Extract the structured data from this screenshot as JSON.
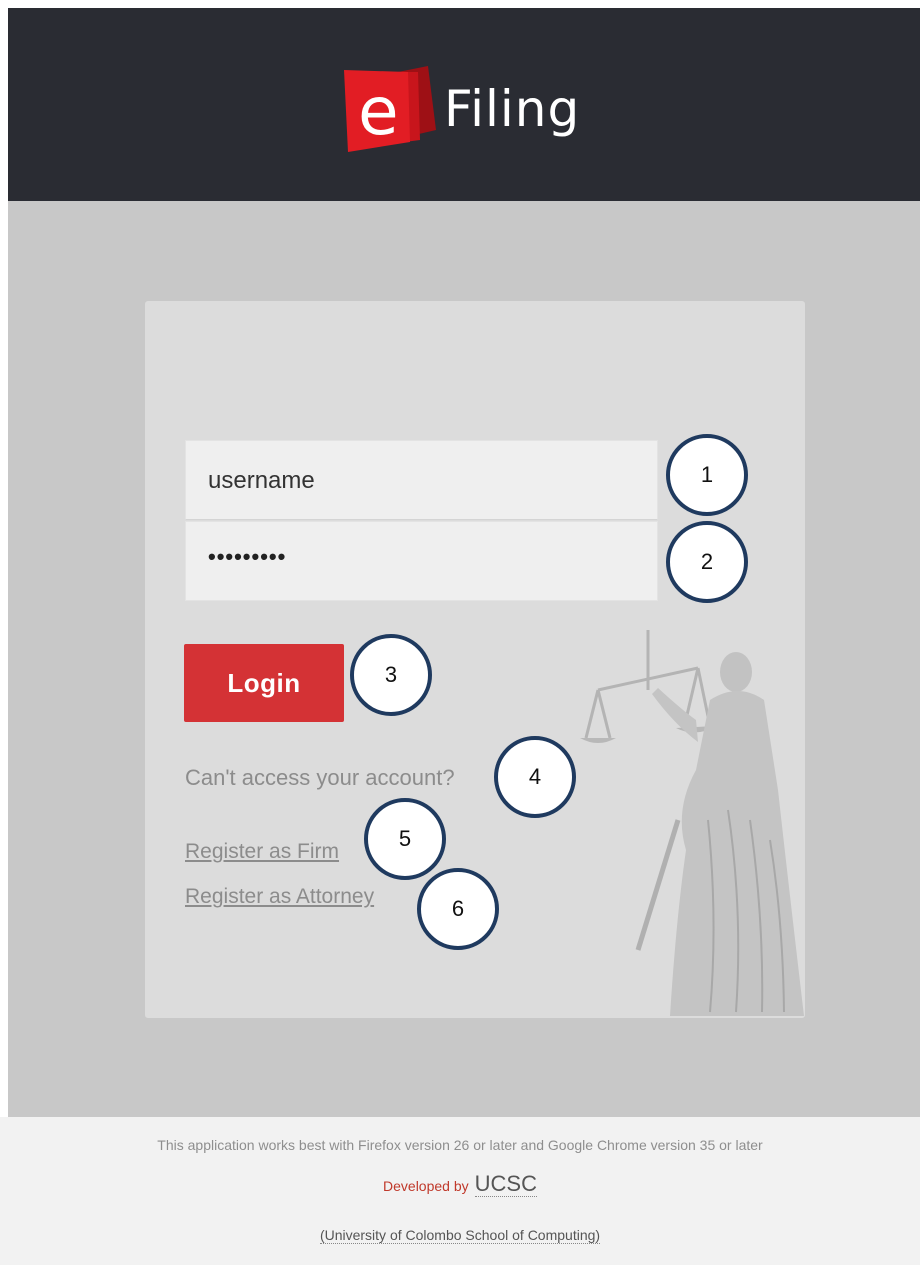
{
  "header": {
    "logo_letter": "e",
    "logo_text": "Filing"
  },
  "login_form": {
    "username_value": "username",
    "password_value": "•••••••••",
    "login_label": "Login",
    "cant_access_label": "Can't access your account?",
    "register_firm_label": "Register as Firm",
    "register_attorney_label": "Register as Attorney"
  },
  "callouts": [
    "1",
    "2",
    "3",
    "4",
    "5",
    "6"
  ],
  "footer": {
    "compat_note": "This application works best with Firefox version 26 or later and Google Chrome version 35 or later",
    "developed_by": "Developed by",
    "org_short": "UCSC",
    "org_full": "(University of Colombo School of Computing)"
  },
  "colors": {
    "header_bg": "#2a2c33",
    "accent_red": "#d43235",
    "callout_border": "#1f3a5f",
    "page_bg": "#c8c8c8",
    "card_bg": "#dcdcdc"
  },
  "icons": {
    "logo": "efiling-logo-icon",
    "watermark": "lady-justice-icon"
  }
}
